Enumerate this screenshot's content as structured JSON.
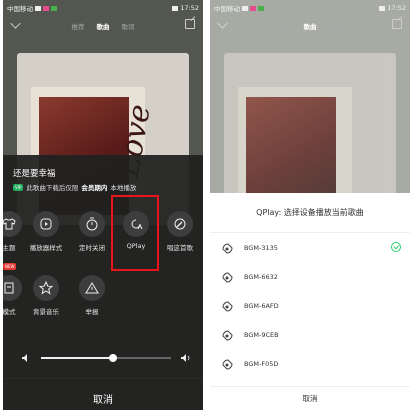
{
  "left": {
    "status": {
      "carrier": "中国移动",
      "time": "17:52"
    },
    "header": {
      "tabs": [
        "推荐",
        "歌曲",
        "歌词"
      ],
      "active": "歌曲"
    },
    "album": {
      "love": "Love"
    },
    "sheet": {
      "song_title": "还是要幸福",
      "vip_badge": "VIP",
      "notice_pre": "此歌曲下载后仅限",
      "notice_bold": "会员期内",
      "notice_post": "本地播放",
      "new_tag": "NEW",
      "row1": [
        {
          "label": "主题",
          "icon": "shirt-icon"
        },
        {
          "label": "播放器样式",
          "icon": "player-style-icon"
        },
        {
          "label": "定时关闭",
          "icon": "timer-icon"
        },
        {
          "label": "QPlay",
          "icon": "qplay-cast-icon"
        },
        {
          "label": "唱这首歌",
          "icon": "karaoke-mic-icon"
        }
      ],
      "row2": [
        {
          "label": "模式",
          "icon": "mode-icon"
        },
        {
          "label": "背景音乐",
          "icon": "background-music-icon"
        },
        {
          "label": "举报",
          "icon": "warning-icon"
        }
      ],
      "volume_level": 0.55,
      "cancel": "取消"
    }
  },
  "right": {
    "status": {
      "carrier": "中国移动",
      "time": "17:52"
    },
    "header": {
      "tabs": [
        "推荐",
        "歌曲",
        "歌词"
      ],
      "active": "歌曲"
    },
    "dialog": {
      "title": "QPlay: 选择设备播放当前歌曲",
      "devices": [
        {
          "name": "BGM-3135",
          "selected": true
        },
        {
          "name": "BGM-6632",
          "selected": false
        },
        {
          "name": "BGM-6AFD",
          "selected": false
        },
        {
          "name": "BGM-9CEB",
          "selected": false
        },
        {
          "name": "BGM-F05D",
          "selected": false
        }
      ],
      "cancel": "取消"
    }
  },
  "colors": {
    "highlight": "#e8161a",
    "check": "#2ecc71",
    "vip": "#27ae60"
  }
}
